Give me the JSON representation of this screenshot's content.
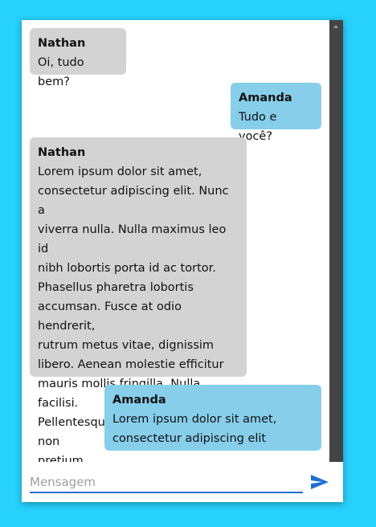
{
  "messages": [
    {
      "author": "Nathan",
      "text": "Oi, tudo bem?",
      "side": "left"
    },
    {
      "author": "Amanda",
      "text": "Tudo e você?",
      "side": "right"
    },
    {
      "author": "Nathan",
      "text": "Lorem ipsum dolor sit amet,\nconsectetur adipiscing elit. Nunc a\nviverra nulla. Nulla maximus leo id\nnibh lobortis porta id ac tortor.\nPhasellus pharetra lobortis\naccumsan. Fusce at odio hendrerit,\nrutrum metus vitae, dignissim\nlibero. Aenean molestie efficitur\nmauris mollis fringilla. Nulla facilisi.\nPellentesque fringilla non nibh non\npretium",
      "side": "left"
    },
    {
      "author": "Amanda",
      "text": "Lorem ipsum dolor sit amet,\nconsectetur adipiscing elit",
      "side": "right"
    }
  ],
  "composer": {
    "placeholder": "Mensagem",
    "value": "",
    "send_icon": "send-icon"
  },
  "colors": {
    "background": "#26d1fb",
    "incoming_bubble": "#d3d3d3",
    "outgoing_bubble": "#87ceeb",
    "input_underline": "#1f6fd1",
    "send_icon": "#1f6fd1",
    "scrollbar": "#444444"
  }
}
